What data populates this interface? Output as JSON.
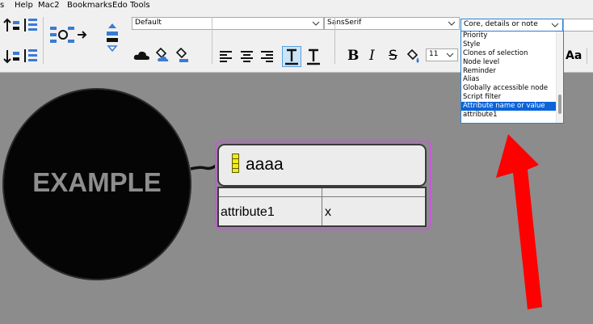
{
  "menubar": {
    "items": [
      "s",
      "Help",
      "Mac2",
      "Bookmarks",
      "Edo Tools"
    ]
  },
  "toolbar": {
    "style_combo": {
      "value": "Default"
    },
    "font_combo": {
      "value": "SansSerif"
    },
    "filter_combo": {
      "value": "Core, details or note"
    },
    "font_size": "11",
    "bold_label": "B",
    "italic_label": "I",
    "strike_label": "S",
    "case_label": "Aa",
    "colors": {
      "toolbar_bg": "#f0f0f0",
      "accent_blue": "#2b7fd4",
      "icon_blue": "#3a7bd5",
      "cloud_black": "#111111"
    }
  },
  "filter_dropdown": {
    "options": [
      "Priority",
      "Style",
      "Clones of selection",
      "Node level",
      "Reminder",
      "Alias",
      "Globally accessible node",
      "Script filter",
      "Attribute name or value",
      "attribute1"
    ],
    "selected": "Attribute name or value",
    "selection_color": "#0a64d8"
  },
  "map": {
    "background": "#8c8c8c",
    "root": {
      "text": "EXAMPLE",
      "fill": "#050505",
      "text_color": "#8e8e8e"
    },
    "child": {
      "text": "aaaa",
      "selection_color": "#c55ad8",
      "attributes": [
        {
          "name": "attribute1",
          "value": "x"
        }
      ]
    },
    "annotation": {
      "shape": "red-arrow",
      "color": "#ff0000"
    }
  }
}
